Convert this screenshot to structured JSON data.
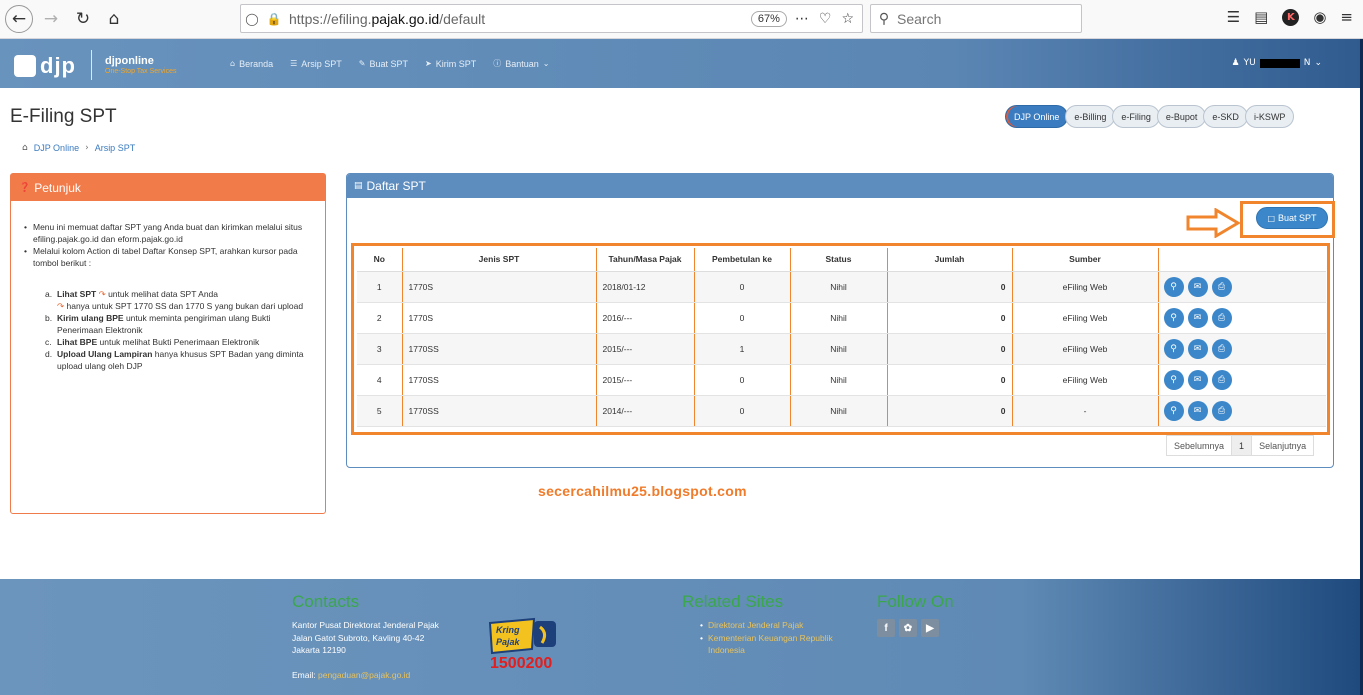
{
  "browser": {
    "url_prefix": "https://efiling.",
    "url_domain": "pajak.go.id",
    "url_path": "/default",
    "zoom": "67%",
    "search_placeholder": "Search"
  },
  "header": {
    "logo_text": "djp",
    "brand_name": "djponline",
    "brand_tagline": "One-Stop Tax Services",
    "nav": [
      {
        "label": "Beranda",
        "icon": "home-icon"
      },
      {
        "label": "Arsip SPT",
        "icon": "list-icon"
      },
      {
        "label": "Buat SPT",
        "icon": "edit-icon"
      },
      {
        "label": "Kirim SPT",
        "icon": "send-icon"
      },
      {
        "label": "Bantuan",
        "icon": "help-icon"
      }
    ],
    "user_name_prefix": "YU",
    "user_name_suffix": "N"
  },
  "page": {
    "title": "E-Filing SPT",
    "breadcrumb": [
      "DJP Online",
      "Arsip SPT"
    ],
    "app_pills": [
      "DJP Online",
      "e-Billing",
      "e-Filing",
      "e-Bupot",
      "e-SKD",
      "i-KSWP"
    ]
  },
  "petunjuk": {
    "title": "Petunjuk",
    "bullet1": "Menu ini memuat daftar SPT yang Anda buat dan kirimkan melalui situs efiling.pajak.go.id dan eform.pajak.go.id",
    "bullet2": "Melalui kolom Action di tabel Daftar Konsep SPT, arahkan kursor pada tombol berikut :",
    "items": [
      {
        "mark": "a.",
        "bold": "Lihat SPT",
        "rest": " untuk melihat data SPT Anda",
        "rest2": " hanya untuk SPT 1770 SS dan 1770 S yang bukan dari upload"
      },
      {
        "mark": "b.",
        "bold": "Kirim ulang BPE",
        "rest": " untuk meminta pengiriman ulang Bukti Penerimaan Elektronik"
      },
      {
        "mark": "c.",
        "bold": "Lihat BPE",
        "rest": " untuk melihat Bukti Penerimaan Elektronik"
      },
      {
        "mark": "d.",
        "bold": "Upload Ulang Lampiran",
        "rest": " hanya khusus SPT Badan yang diminta upload ulang oleh DJP"
      }
    ]
  },
  "daftar": {
    "title": "Daftar SPT",
    "buat_label": "Buat SPT",
    "columns": [
      "No",
      "Jenis SPT",
      "Tahun/Masa Pajak",
      "Pembetulan ke",
      "Status",
      "Jumlah",
      "Sumber",
      ""
    ],
    "rows": [
      {
        "no": "1",
        "jenis": "1770S",
        "tahun": "2018/01-12",
        "pembetulan": "0",
        "status": "Nihil",
        "jumlah": "0",
        "sumber": "eFiling Web"
      },
      {
        "no": "2",
        "jenis": "1770S",
        "tahun": "2016/---",
        "pembetulan": "0",
        "status": "Nihil",
        "jumlah": "0",
        "sumber": "eFiling Web"
      },
      {
        "no": "3",
        "jenis": "1770SS",
        "tahun": "2015/---",
        "pembetulan": "1",
        "status": "Nihil",
        "jumlah": "0",
        "sumber": "eFiling Web"
      },
      {
        "no": "4",
        "jenis": "1770SS",
        "tahun": "2015/---",
        "pembetulan": "0",
        "status": "Nihil",
        "jumlah": "0",
        "sumber": "eFiling Web"
      },
      {
        "no": "5",
        "jenis": "1770SS",
        "tahun": "2014/---",
        "pembetulan": "0",
        "status": "Nihil",
        "jumlah": "0",
        "sumber": "-"
      }
    ],
    "pager": {
      "prev": "Sebelumnya",
      "current": "1",
      "next": "Selanjutnya"
    }
  },
  "watermark": "secercahilmu25.blogspot.com",
  "footer": {
    "contacts_title": "Contacts",
    "address1": "Kantor Pusat Direktorat Jenderal Pajak",
    "address2": "Jalan Gatot Subroto, Kavling 40-42",
    "address3": "Jakarta 12190",
    "email_label": "Email:",
    "email": "pengaduan@pajak.go.id",
    "kring_text": "Kring Pajak",
    "kring_number": "1500200",
    "related_title": "Related Sites",
    "related": [
      "Direktorat Jenderal Pajak",
      "Kementerian Keuangan Republik Indonesia"
    ],
    "follow_title": "Follow On"
  }
}
